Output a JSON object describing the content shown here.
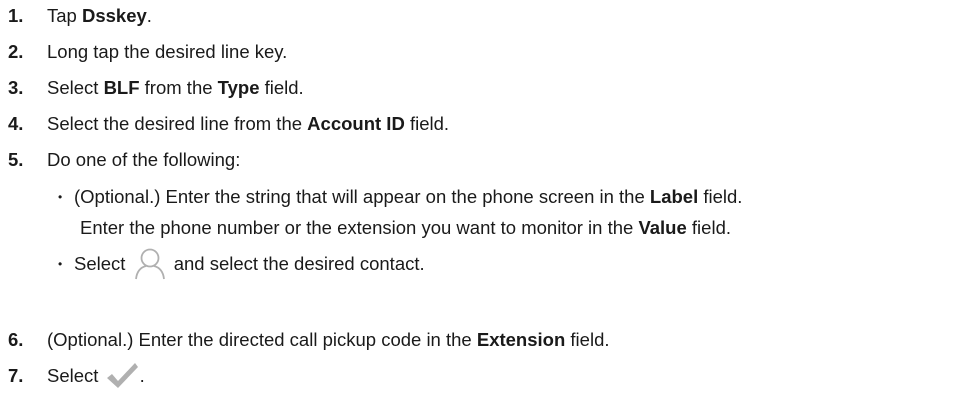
{
  "steps": [
    {
      "num": "1.",
      "pre": "Tap ",
      "b1": "Dsskey",
      "post": "."
    },
    {
      "num": "2.",
      "text": "Long tap the desired line key."
    },
    {
      "num": "3.",
      "pre": "Select ",
      "b1": "BLF",
      "mid": " from the ",
      "b2": "Type",
      "post": " field."
    },
    {
      "num": "4.",
      "pre": "Select the desired line from the ",
      "b1": "Account ID",
      "post": " field."
    },
    {
      "num": "5.",
      "text": "Do one of the following:"
    },
    {
      "num": "6.",
      "pre": "(Optional.) Enter the directed call pickup code in the ",
      "b1": "Extension",
      "post": " field."
    },
    {
      "num": "7.",
      "pre": "Select ",
      "post": "."
    }
  ],
  "sub_items": [
    {
      "line1_pre": "(Optional.) Enter the string that will appear on the phone screen in the ",
      "line1_b": "Label",
      "line1_post": " field.",
      "line2_pre": "Enter the phone number or the extension you want to monitor in the ",
      "line2_b": "Value",
      "line2_post": " field."
    },
    {
      "pre": "Select ",
      "post": " and select the desired contact."
    }
  ],
  "bullet_glyph": "•",
  "icons": {
    "contact": "contact-icon",
    "confirm": "checkmark-icon"
  },
  "colors": {
    "text": "#1a1a1a",
    "icon_gray": "#b0b0b0"
  }
}
